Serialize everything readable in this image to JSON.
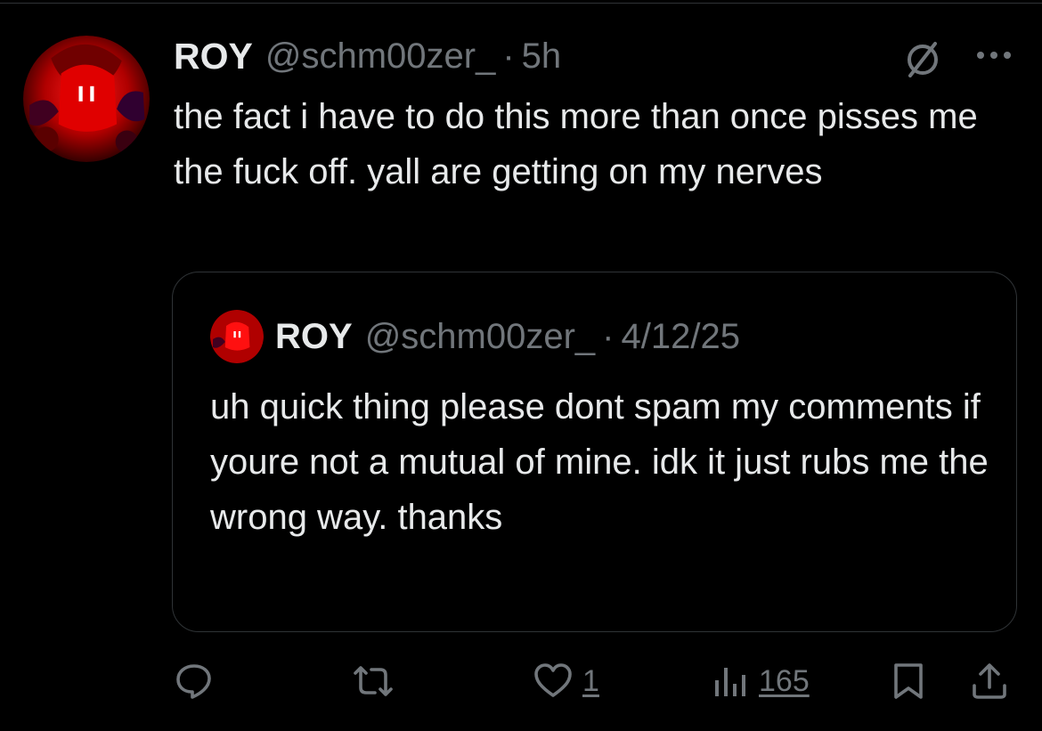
{
  "tweet": {
    "author_name": "ROY",
    "handle": "@schm00zer_",
    "separator": "·",
    "time": "5h",
    "text": "the fact i have to do this more than once pisses me the fuck off. yall are getting on my nerves"
  },
  "quoted_tweet": {
    "author_name": "ROY",
    "handle": "@schm00zer_",
    "separator": "·",
    "time": "4/12/25",
    "text": "uh quick thing please dont spam my comments if youre not a mutual of mine. idk it just rubs me the wrong way. thanks"
  },
  "actions": {
    "reply_count": "",
    "retweet_count": "",
    "like_count": "1",
    "views_count": "165"
  },
  "icons": {
    "header_right": [
      "no-entry-icon",
      "more-icon"
    ],
    "actions": [
      "reply-icon",
      "retweet-icon",
      "like-icon",
      "views-icon",
      "bookmark-icon",
      "share-icon"
    ]
  },
  "colors": {
    "background": "#000000",
    "text_primary": "#e7e9ea",
    "text_secondary": "#71767b",
    "border": "#2f3336",
    "avatar_accent": "#d10000"
  }
}
